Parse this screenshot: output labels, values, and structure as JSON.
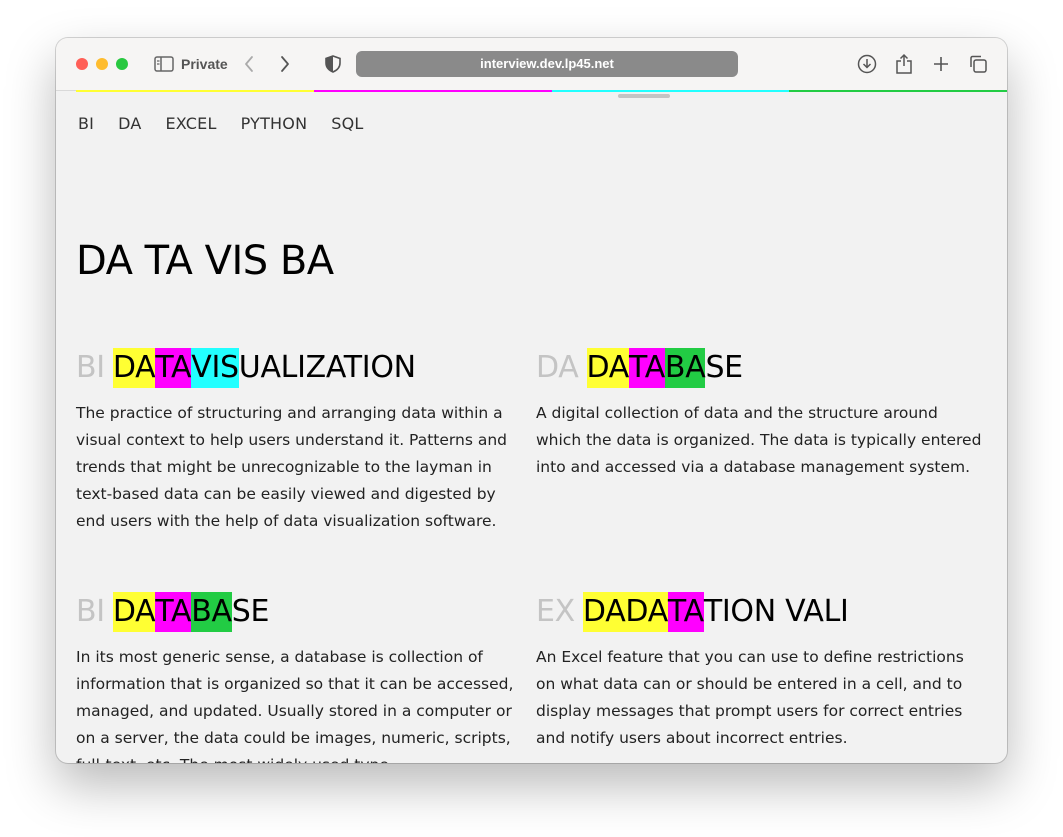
{
  "browser": {
    "mode_label": "Private",
    "url": "interview.dev.lp45.net"
  },
  "colors": {
    "yellow": "#ffff33",
    "magenta": "#ff00ff",
    "cyan": "#22ffff",
    "green": "#22cc44",
    "category_gray": "#c4c4c4"
  },
  "nav": {
    "items": [
      "BI",
      "DA",
      "EXCEL",
      "PYTHON",
      "SQL"
    ]
  },
  "hero": {
    "title": "DA TA VIS BA"
  },
  "cards": [
    {
      "category": "BI",
      "segments": [
        {
          "text": "DA",
          "color": "#ffff33"
        },
        {
          "text": "TA",
          "color": "#ff00ff"
        },
        {
          "text": "VIS",
          "color": "#22ffff"
        },
        {
          "text": "UALIZATION",
          "color": ""
        }
      ],
      "description": "The practice of structuring and arranging data within a visual context to help users understand it. Patterns and trends that might be unrecognizable to the layman in text-based data can be easily viewed and digested by end users with the help of data visualization software."
    },
    {
      "category": "DA",
      "segments": [
        {
          "text": "DA",
          "color": "#ffff33"
        },
        {
          "text": "TA",
          "color": "#ff00ff"
        },
        {
          "text": "BA",
          "color": "#22cc44"
        },
        {
          "text": "SE",
          "color": ""
        }
      ],
      "description": "A digital collection of data and the structure around which the data is organized. The data is typically entered into and accessed via a database management system."
    },
    {
      "category": "BI",
      "segments": [
        {
          "text": "DA",
          "color": "#ffff33"
        },
        {
          "text": "TA",
          "color": "#ff00ff"
        },
        {
          "text": "BA",
          "color": "#22cc44"
        },
        {
          "text": "SE",
          "color": ""
        }
      ],
      "description": "In its most generic sense, a database is collection of information that is organized so that it can be accessed, managed, and updated. Usually stored in a computer or on a server, the data could be images, numeric, scripts, full-text, etc. The most widely used type..."
    },
    {
      "category": "EX",
      "segments": [
        {
          "text": "DADA",
          "color": "#ffff33"
        },
        {
          "text": "TA",
          "color": "#ff00ff"
        },
        {
          "text": "TION VALI",
          "color": ""
        }
      ],
      "description": "An Excel feature that you can use to define restrictions on what data can or should be entered in a cell, and to display messages that prompt users for correct entries and notify users about incorrect entries."
    }
  ]
}
